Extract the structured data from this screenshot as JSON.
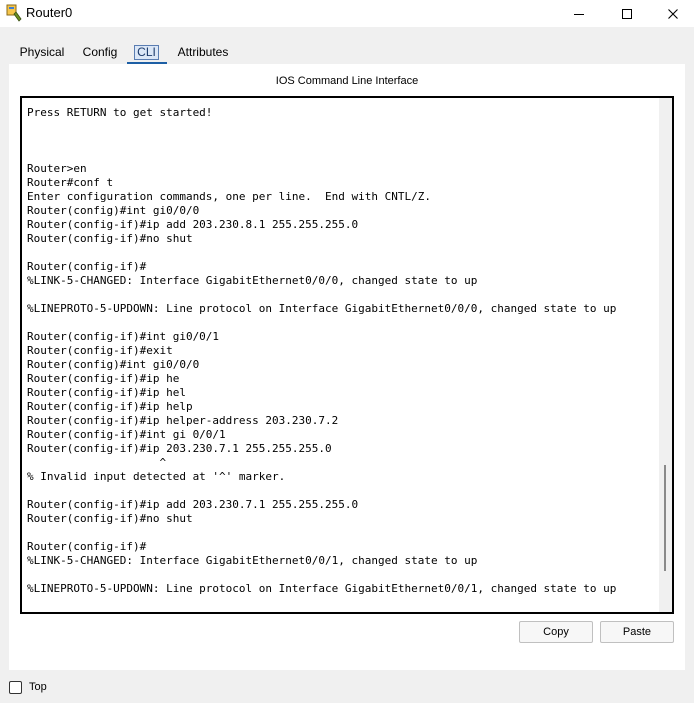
{
  "window": {
    "title": "Router0",
    "icon": "router-icon"
  },
  "window_controls": {
    "minimize": "minimize-icon",
    "maximize": "maximize-icon",
    "close": "close-icon"
  },
  "tabs": [
    {
      "label": "Physical"
    },
    {
      "label": "Config"
    },
    {
      "label": "CLI",
      "selected": true
    },
    {
      "label": "Attributes"
    }
  ],
  "panel": {
    "title": "IOS Command Line Interface"
  },
  "console": {
    "lines": [
      "Press RETURN to get started!",
      "",
      "",
      "",
      "Router>en",
      "Router#conf t",
      "Enter configuration commands, one per line.  End with CNTL/Z.",
      "Router(config)#int gi0/0/0",
      "Router(config-if)#ip add 203.230.8.1 255.255.255.0",
      "Router(config-if)#no shut",
      "",
      "Router(config-if)#",
      "%LINK-5-CHANGED: Interface GigabitEthernet0/0/0, changed state to up",
      "",
      "%LINEPROTO-5-UPDOWN: Line protocol on Interface GigabitEthernet0/0/0, changed state to up",
      "",
      "Router(config-if)#int gi0/0/1",
      "Router(config-if)#exit",
      "Router(config)#int gi0/0/0",
      "Router(config-if)#ip he",
      "Router(config-if)#ip hel",
      "Router(config-if)#ip help",
      "Router(config-if)#ip helper-address 203.230.7.2",
      "Router(config-if)#int gi 0/0/1",
      "Router(config-if)#ip 203.230.7.1 255.255.255.0",
      "                    ^",
      "% Invalid input detected at '^' marker.",
      "",
      "Router(config-if)#ip add 203.230.7.1 255.255.255.0",
      "Router(config-if)#no shut",
      "",
      "Router(config-if)#",
      "%LINK-5-CHANGED: Interface GigabitEthernet0/0/1, changed state to up",
      "",
      "%LINEPROTO-5-UPDOWN: Line protocol on Interface GigabitEthernet0/0/1, changed state to up"
    ]
  },
  "buttons": {
    "copy": "Copy",
    "paste": "Paste"
  },
  "footer": {
    "top_label": "Top",
    "top_checked": false
  }
}
